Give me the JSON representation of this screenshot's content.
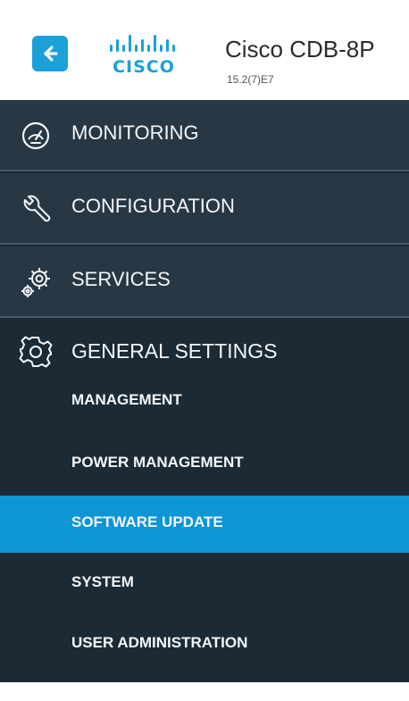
{
  "header": {
    "back_icon": "arrow-left-icon",
    "logo_text": "CISCO",
    "device_name": "Cisco CDB-8P",
    "version": "15.2(7)E7"
  },
  "menu": {
    "items": [
      {
        "label": "MONITORING",
        "icon": "speedometer-icon"
      },
      {
        "label": "CONFIGURATION",
        "icon": "wrench-icon"
      },
      {
        "label": "SERVICES",
        "icon": "gears-icon"
      }
    ],
    "section": {
      "label": "GENERAL SETTINGS",
      "icon": "gear-icon",
      "subitems": [
        {
          "label": "MANAGEMENT",
          "active": false
        },
        {
          "label": "POWER MANAGEMENT",
          "active": false
        },
        {
          "label": "SOFTWARE UPDATE",
          "active": true
        },
        {
          "label": "SYSTEM",
          "active": false
        },
        {
          "label": "USER ADMINISTRATION",
          "active": false
        }
      ]
    }
  },
  "colors": {
    "accent": "#0d96d6",
    "sidebar_bg": "#1b2a35",
    "item_bg": "#273743",
    "divider": "#4c5a65",
    "back_button": "#1ba0d7"
  }
}
